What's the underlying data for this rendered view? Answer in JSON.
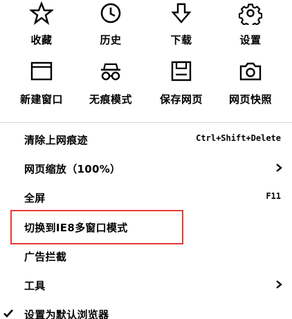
{
  "grid": {
    "row1": [
      {
        "label": "收藏",
        "icon": "star-icon"
      },
      {
        "label": "历史",
        "icon": "clock-icon"
      },
      {
        "label": "下载",
        "icon": "download-icon"
      },
      {
        "label": "设置",
        "icon": "gear-icon"
      }
    ],
    "row2": [
      {
        "label": "新建窗口",
        "icon": "new-window-icon"
      },
      {
        "label": "无痕模式",
        "icon": "incognito-icon"
      },
      {
        "label": "保存网页",
        "icon": "save-icon"
      },
      {
        "label": "网页快照",
        "icon": "camera-icon"
      }
    ]
  },
  "menu": {
    "clear_history": {
      "label": "清除上网痕迹",
      "shortcut": "Ctrl+Shift+Delete"
    },
    "zoom": {
      "label": "网页缩放（100%）"
    },
    "fullscreen": {
      "label": "全屏",
      "shortcut": "F11"
    },
    "ie_mode": {
      "label": "切换到IE8多窗口模式"
    },
    "adblock": {
      "label": "广告拦截"
    },
    "tools": {
      "label": "工具"
    },
    "default_browser": {
      "label": "设置为默认浏览器"
    }
  },
  "colors": {
    "highlight_border": "#e53935",
    "divider": "#d9d9d9",
    "text": "#000000"
  }
}
